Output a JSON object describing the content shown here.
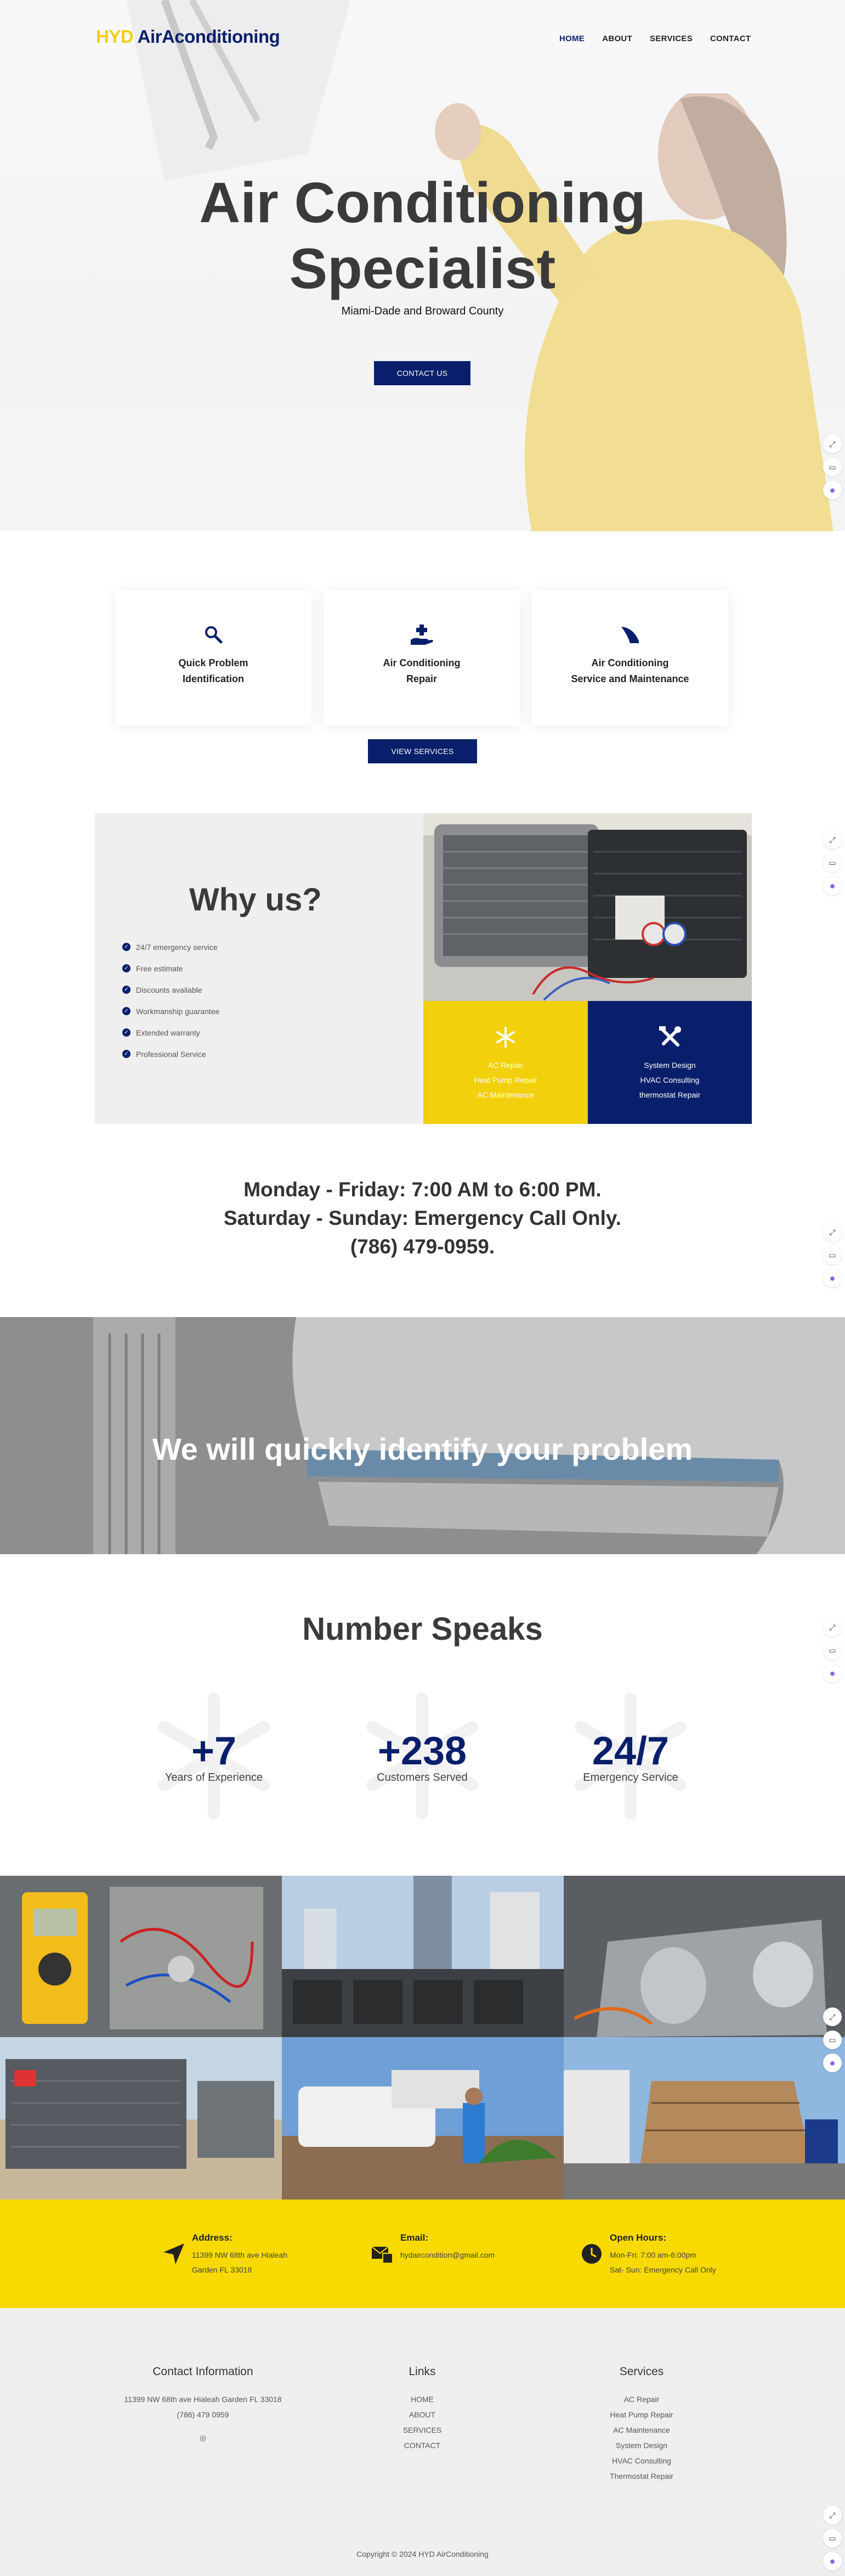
{
  "brand": {
    "part1": "HYD",
    "part2": "AirAconditioning"
  },
  "nav": [
    "HOME",
    "ABOUT",
    "SERVICES",
    "CONTACT"
  ],
  "hero": {
    "title_line1": "Air Conditioning",
    "title_line2": "Specialist",
    "subtitle": "Miami-Dade and Broward County",
    "cta": "CONTACT US"
  },
  "features": {
    "cards": [
      {
        "icon": "search-icon",
        "line1": "Quick Problem",
        "line2": "Identification"
      },
      {
        "icon": "hand-plus-icon",
        "line1": "Air Conditioning",
        "line2": "Repair"
      },
      {
        "icon": "fan-blade-icon",
        "line1": "Air Conditioning",
        "line2": "Service and Maintenance"
      }
    ],
    "button": "VIEW SERVICES"
  },
  "why": {
    "title": "Why us?",
    "items": [
      "24/7 emergency service",
      "Free estimate",
      "Discounts available",
      "Workmanship guarantee",
      "Extended warranty",
      "Professional Service"
    ],
    "yellow": [
      "AC Repair",
      "Heat Pump Repair",
      "AC Maintenance"
    ],
    "blue": [
      "System Design",
      "HVAC Consulting",
      "thermostat Repair"
    ]
  },
  "hours": {
    "line1": "Monday - Friday: 7:00 AM to 6:00 PM.",
    "line2": "Saturday - Sunday: Emergency Call Only.",
    "line3": "(786) 479-0959."
  },
  "banner": {
    "text": "We will quickly identify your problem"
  },
  "numbers": {
    "title": "Number Speaks",
    "stats": [
      {
        "value": "+7",
        "label": "Years of Experience"
      },
      {
        "value": "+238",
        "label": "Customers Served"
      },
      {
        "value": "24/7",
        "label": "Emergency Service"
      }
    ]
  },
  "contact": {
    "address_label": "Address:",
    "address_line1": "11399 NW 68th ave Hialeah",
    "address_line2": "Garden FL 33018",
    "email_label": "Email:",
    "email": "hydaircondition@gmail.com",
    "hours_label": "Open Hours:",
    "hours_line1": "Mon-Fri: 7:00 am-6:00pm",
    "hours_line2": "Sat- Sun: Emergency Call Only"
  },
  "footer": {
    "info_title": "Contact Information",
    "info_address": "11399 NW 68th ave Hialeah Garden FL 33018",
    "info_phone": "(786) 479 0959",
    "links_title": "Links",
    "links": [
      "HOME",
      "ABOUT",
      "SERVICES",
      "CONTACT"
    ],
    "services_title": "Services",
    "services": [
      "AC Repair",
      "Heat Pump Repair",
      "AC Maintenance",
      "System Design",
      "HVAC Consulting",
      "Thermostat Repair"
    ],
    "copyright": "Copyright © 2024 HYD AirConditioning"
  },
  "colors": {
    "navy": "#0a1f6b",
    "yellow": "#f2d00c"
  }
}
